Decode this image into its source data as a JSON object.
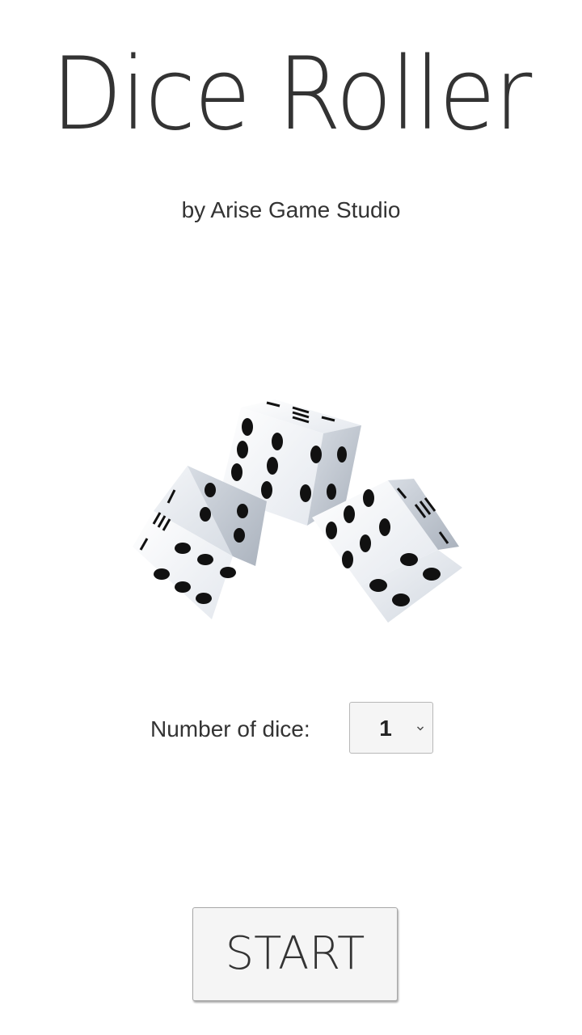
{
  "app": {
    "title": "Dice Roller",
    "subtitle": "by Arise Game Studio"
  },
  "settings": {
    "dice_count_label": "Number of dice:",
    "dice_count_value": "1"
  },
  "actions": {
    "start_label": "START"
  },
  "illustration": {
    "icon": "three-dice-icon"
  },
  "colors": {
    "text": "#333333",
    "background": "#ffffff",
    "button_bg": "#f5f5f5",
    "pip": "#111111"
  }
}
